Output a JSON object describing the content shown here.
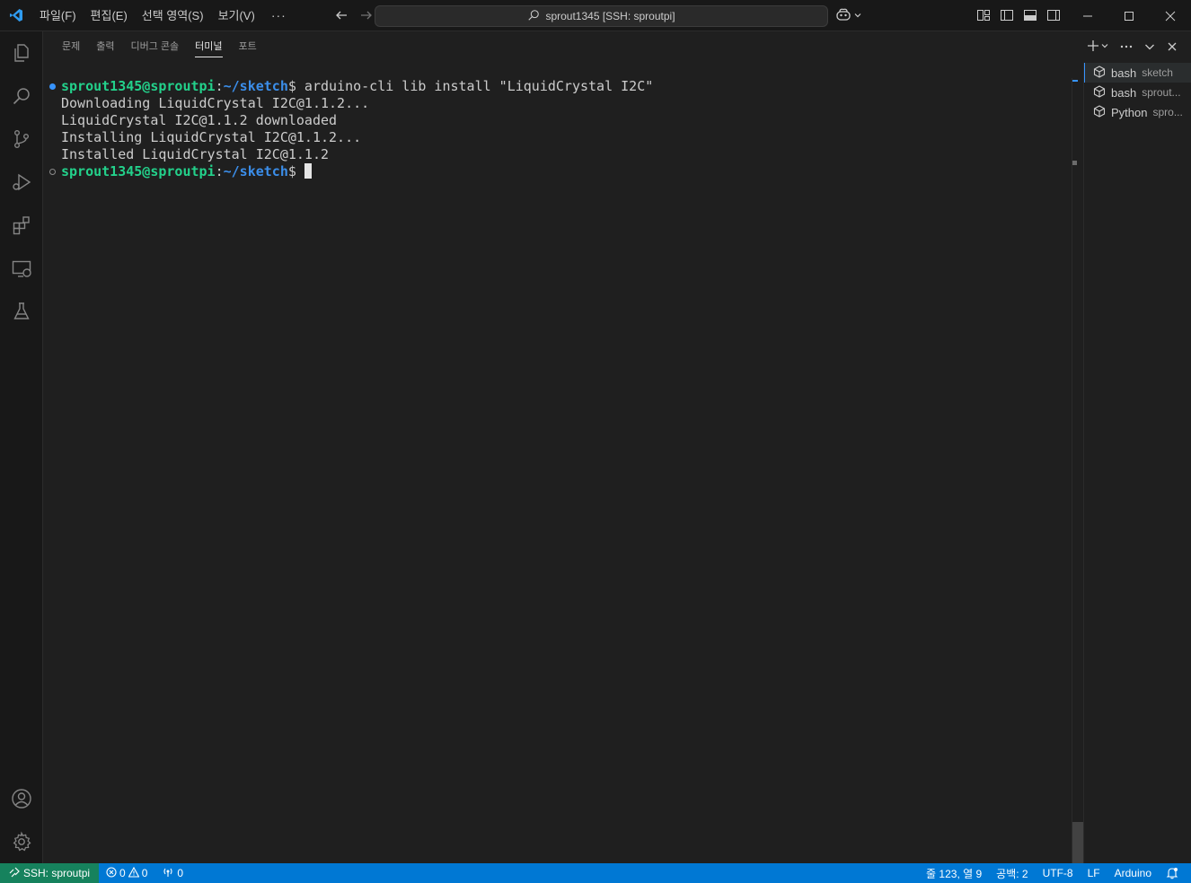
{
  "window": {
    "title": "sprout1345 [SSH: sproutpi]",
    "menu": [
      "파일(F)",
      "편집(E)",
      "선택 영역(S)",
      "보기(V)"
    ],
    "more": "···"
  },
  "panel": {
    "tabs": [
      "문제",
      "출력",
      "디버그 콘솔",
      "터미널",
      "포트"
    ],
    "active_tab": "터미널"
  },
  "terminal": {
    "prompt_user": "sprout1345@sproutpi",
    "prompt_sep": ":",
    "prompt_path": "~/sketch",
    "prompt_end": "$",
    "command": " arduino-cli lib install \"LiquidCrystal I2C\"",
    "output": [
      "Downloading LiquidCrystal I2C@1.1.2...",
      "LiquidCrystal I2C@1.1.2 downloaded",
      "Installing LiquidCrystal I2C@1.1.2...",
      "Installed LiquidCrystal I2C@1.1.2"
    ]
  },
  "terminal_list": [
    {
      "name": "bash",
      "desc": "sketch"
    },
    {
      "name": "bash",
      "desc": "sprout..."
    },
    {
      "name": "Python",
      "desc": "spro..."
    }
  ],
  "statusbar": {
    "remote": "SSH: sproutpi",
    "errors": "0",
    "warnings": "0",
    "ports": "0",
    "position": "줄 123, 열 9",
    "spaces": "공백: 2",
    "encoding": "UTF-8",
    "eol": "LF",
    "language": "Arduino"
  },
  "colors": {
    "accent": "#0078d4",
    "remote": "#16825d",
    "prompt_user": "#23d18b",
    "prompt_path": "#3b8eea"
  }
}
